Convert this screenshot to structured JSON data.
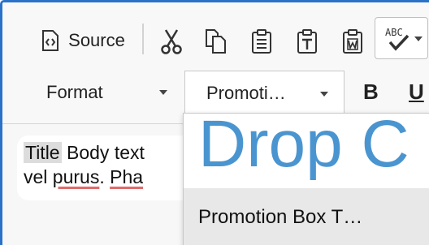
{
  "toolbar": {
    "source_label": "Source",
    "icons": [
      "source-icon",
      "cut-icon",
      "copy-icon",
      "paste-icon",
      "paste-text-icon",
      "paste-from-word-icon",
      "spellcheck-icon"
    ],
    "spellcheck_label": "ABC",
    "format_label": "Format",
    "styles_value": "Promoti…",
    "bold_label": "B",
    "underline_label": "U"
  },
  "editor": {
    "style_tag": "Title",
    "line1_rest": " Body text",
    "line2_a": "vel ",
    "line2_b": "purus",
    "line2_c": ". ",
    "line2_d": "Pha"
  },
  "styles_menu": {
    "items": [
      {
        "label": "Drop C"
      },
      {
        "label": "Promotion Box T…"
      }
    ]
  },
  "colors": {
    "accent": "#2a72c9",
    "dropcap": "#4a95d0",
    "spell_error": "#e26a6a"
  }
}
